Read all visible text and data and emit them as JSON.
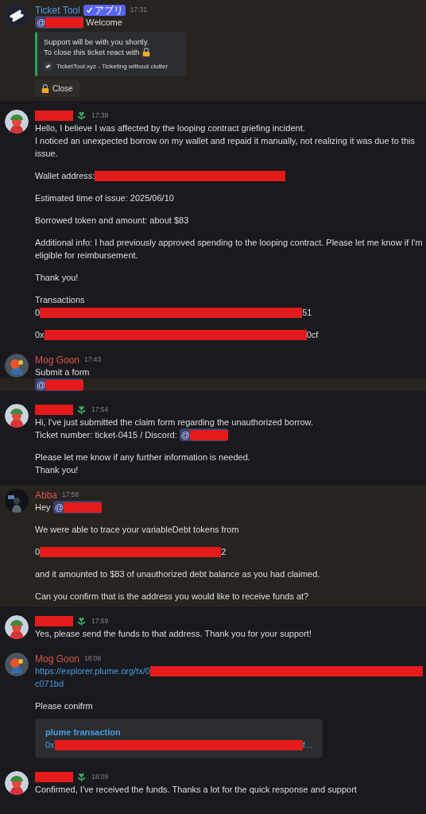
{
  "messages": [
    {
      "avatar": {
        "kind": "bot"
      },
      "highlighted": true,
      "author": {
        "kind": "named",
        "name": "Ticket Tool",
        "color": "#4f9ce0",
        "tag": "アプリ"
      },
      "time": "17:31",
      "paragraphs": [
        [
          {
            "highlighted": false,
            "segments": [
              {
                "kind": "mention",
                "text": "@"
              },
              {
                "kind": "text",
                "text": " Welcome"
              }
            ]
          }
        ]
      ],
      "embed": {
        "kind": "ticket",
        "lines": [
          "Support will be with you shortly.",
          "To close this ticket react with"
        ],
        "footer": "TicketTool.xyz - Ticketing without clutter"
      },
      "button": {
        "label": "Close"
      }
    },
    {
      "avatar": {
        "kind": "user"
      },
      "highlighted": false,
      "author": {
        "kind": "redacted"
      },
      "time": "17:38",
      "paragraphs": [
        [
          {
            "highlighted": false,
            "segments": [
              {
                "kind": "text",
                "text": "Hello, I believe I was affected by the looping contract griefing incident."
              }
            ]
          },
          {
            "highlighted": false,
            "segments": [
              {
                "kind": "text",
                "text": "I noticed an unexpected borrow on my wallet and repaid it manually, not realizing it was due to this issue."
              }
            ]
          }
        ],
        [
          {
            "highlighted": false,
            "segments": [
              {
                "kind": "text",
                "text": "Wallet address:"
              },
              {
                "kind": "redacted-medium"
              }
            ]
          }
        ],
        [
          {
            "highlighted": false,
            "segments": [
              {
                "kind": "text",
                "text": "Estimated time of issue: 2025/06/10"
              }
            ]
          }
        ],
        [
          {
            "highlighted": false,
            "segments": [
              {
                "kind": "text",
                "text": "Borrowed token and amount: about $83"
              }
            ]
          }
        ],
        [
          {
            "highlighted": false,
            "segments": [
              {
                "kind": "text",
                "text": "Additional info: I had previously approved spending to the looping contract. Please let me know if I'm eligible for reimbursement."
              }
            ]
          }
        ],
        [
          {
            "highlighted": false,
            "segments": [
              {
                "kind": "text",
                "text": "Thank you!"
              }
            ]
          }
        ],
        [
          {
            "highlighted": false,
            "segments": [
              {
                "kind": "text",
                "text": "Transactions"
              }
            ]
          },
          {
            "highlighted": false,
            "segments": [
              {
                "kind": "text",
                "text": "0"
              },
              {
                "kind": "redacted-long"
              },
              {
                "kind": "text",
                "text": "51"
              }
            ]
          }
        ],
        [
          {
            "highlighted": false,
            "segments": [
              {
                "kind": "text",
                "text": "0x"
              },
              {
                "kind": "redacted-long"
              },
              {
                "kind": "text",
                "text": "0cf"
              }
            ]
          }
        ]
      ]
    },
    {
      "avatar": {
        "kind": "staff"
      },
      "highlighted": false,
      "author": {
        "kind": "named",
        "name": "Mog Goon",
        "color": "#d9534a"
      },
      "time": "17:43",
      "paragraphs": [
        [
          {
            "highlighted": false,
            "segments": [
              {
                "kind": "text",
                "text": "Submit a form"
              }
            ]
          },
          {
            "highlighted": true,
            "segments": [
              {
                "kind": "mention",
                "text": "@"
              }
            ]
          }
        ]
      ]
    },
    {
      "avatar": {
        "kind": "user"
      },
      "highlighted": false,
      "author": {
        "kind": "redacted"
      },
      "time": "17:54",
      "paragraphs": [
        [
          {
            "highlighted": false,
            "segments": [
              {
                "kind": "text",
                "text": "Hi, I've just submitted the claim form regarding the unauthorized borrow."
              }
            ]
          },
          {
            "highlighted": false,
            "segments": [
              {
                "kind": "text",
                "text": "Ticket number: ticket-0415 / Discord: "
              },
              {
                "kind": "mention",
                "text": "@"
              }
            ]
          }
        ],
        [
          {
            "highlighted": false,
            "segments": [
              {
                "kind": "text",
                "text": "Please let me know if any further information is needed."
              }
            ]
          },
          {
            "highlighted": false,
            "segments": [
              {
                "kind": "text",
                "text": "Thank you!"
              }
            ]
          }
        ]
      ]
    },
    {
      "avatar": {
        "kind": "staff-dark"
      },
      "highlighted": true,
      "author": {
        "kind": "named",
        "name": "Abba",
        "color": "#d9534a"
      },
      "time": "17:58",
      "paragraphs": [
        [
          {
            "highlighted": false,
            "segments": [
              {
                "kind": "text",
                "text": "Hey "
              },
              {
                "kind": "mention",
                "text": "@"
              }
            ]
          }
        ],
        [
          {
            "highlighted": false,
            "segments": [
              {
                "kind": "text",
                "text": "We were able to trace your variableDebt tokens from"
              }
            ]
          }
        ],
        [
          {
            "highlighted": false,
            "segments": [
              {
                "kind": "text",
                "text": "0"
              },
              {
                "kind": "redacted-wide"
              },
              {
                "kind": "text",
                "text": "2"
              }
            ]
          }
        ],
        [
          {
            "highlighted": false,
            "segments": [
              {
                "kind": "text",
                "text": "and it amounted to $83 of unauthorized debt balance as you had claimed."
              }
            ]
          }
        ],
        [
          {
            "highlighted": false,
            "segments": [
              {
                "kind": "text",
                "text": "Can you confirm that is the address you would like to receive funds at?"
              }
            ]
          }
        ]
      ]
    },
    {
      "avatar": {
        "kind": "user"
      },
      "highlighted": false,
      "author": {
        "kind": "redacted"
      },
      "time": "17:59",
      "paragraphs": [
        [
          {
            "highlighted": false,
            "segments": [
              {
                "kind": "text",
                "text": "Yes, please send the funds to that address. Thank you for your support!"
              }
            ]
          }
        ]
      ]
    },
    {
      "avatar": {
        "kind": "staff"
      },
      "highlighted": false,
      "author": {
        "kind": "named",
        "name": "Mog Goon",
        "color": "#d9534a"
      },
      "time": "18:06",
      "paragraphs": [
        [
          {
            "highlighted": false,
            "segments": [
              {
                "kind": "link",
                "text": "https://explorer.plume.org/tx/0"
              },
              {
                "kind": "redacted-fill"
              }
            ]
          },
          {
            "highlighted": false,
            "segments": [
              {
                "kind": "link",
                "text": "c071bd"
              }
            ]
          }
        ],
        [
          {
            "highlighted": false,
            "segments": [
              {
                "kind": "text",
                "text": "Please conifrm"
              }
            ]
          }
        ]
      ],
      "embed": {
        "kind": "link",
        "title": "plume transaction",
        "segments": [
          {
            "kind": "link",
            "text": "0x"
          },
          {
            "kind": "redacted-long"
          },
          {
            "kind": "link",
            "text": "f..."
          }
        ]
      }
    },
    {
      "avatar": {
        "kind": "user"
      },
      "highlighted": false,
      "author": {
        "kind": "redacted"
      },
      "time": "18:09",
      "paragraphs": [
        [
          {
            "highlighted": false,
            "segments": [
              {
                "kind": "text",
                "text": "Confirmed, I've received the funds. Thanks a lot for the quick response and support"
              }
            ]
          }
        ]
      ]
    }
  ]
}
